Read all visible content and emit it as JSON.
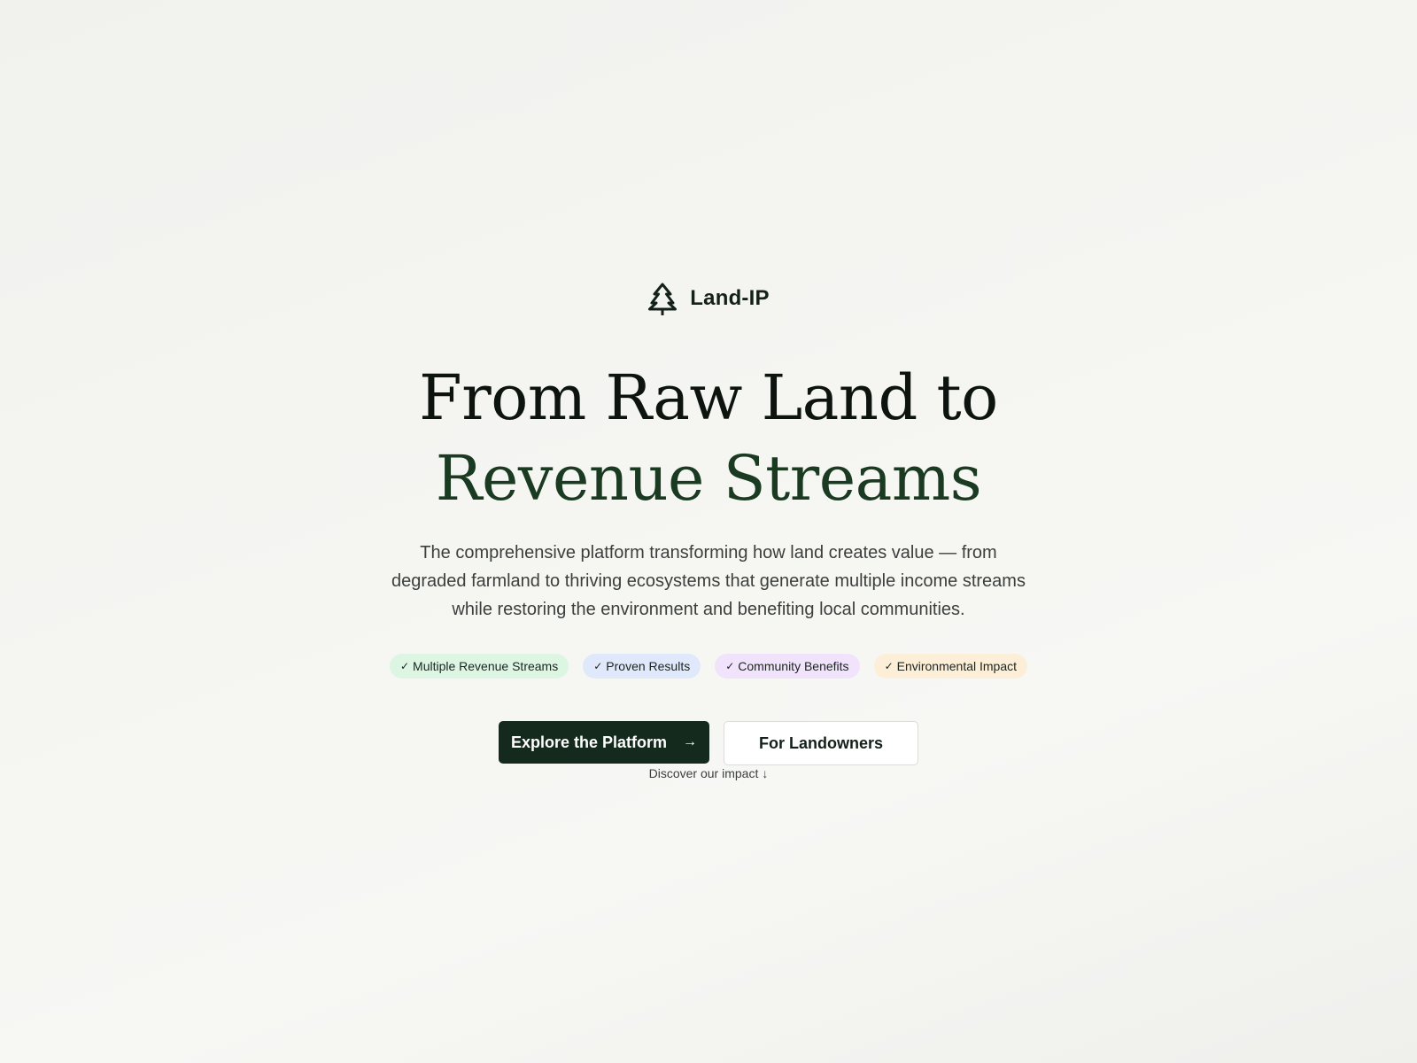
{
  "brand": {
    "icon": "pine-tree-icon",
    "name": "Land-IP"
  },
  "headline": {
    "line1": "From Raw Land to",
    "line2": "Revenue Streams"
  },
  "subtitle": "The comprehensive platform transforming how land creates value — from degraded farmland to thriving ecosystems that generate multiple income streams while restoring the environment and benefiting local communities.",
  "tags": [
    {
      "check": "✓",
      "label": "Multiple Revenue Streams",
      "color": "#ddf6e3"
    },
    {
      "check": "✓",
      "label": "Proven Results",
      "color": "#dfe9fb"
    },
    {
      "check": "✓",
      "label": "Community Benefits",
      "color": "#f1e3fb"
    },
    {
      "check": "✓",
      "label": "Environmental Impact",
      "color": "#fdeed7"
    }
  ],
  "cta": {
    "primary_label": "Explore the Platform",
    "primary_arrow": "→",
    "secondary_label": "For Landowners"
  },
  "discover": {
    "label": "Discover our impact",
    "arrow": "↓"
  },
  "colors": {
    "accent_dark_green": "#142a1c",
    "headline_green": "#1a3a22"
  }
}
